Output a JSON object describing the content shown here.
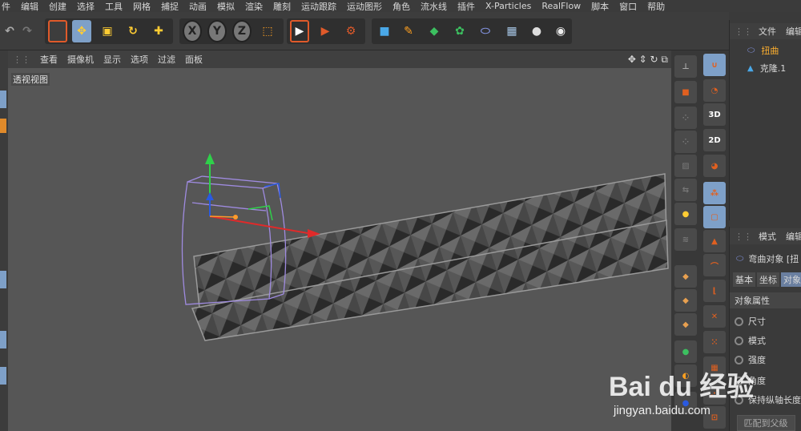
{
  "menu": [
    "件",
    "编辑",
    "创建",
    "选择",
    "工具",
    "网格",
    "捕捉",
    "动画",
    "模拟",
    "渲染",
    "雕刻",
    "运动跟踪",
    "运动图形",
    "角色",
    "流水线",
    "插件",
    "X-Particles",
    "RealFlow",
    "脚本",
    "窗口",
    "帮助"
  ],
  "toolbar": {
    "axis_x": "X",
    "axis_y": "Y",
    "axis_z": "Z"
  },
  "viewport": {
    "menu": [
      "查看",
      "摄像机",
      "显示",
      "选项",
      "过滤",
      "面板"
    ],
    "label": "透视视图"
  },
  "right_tools": {
    "btn_3d": "3D",
    "btn_2d": "2D"
  },
  "object_manager": {
    "tabs": [
      "文件",
      "编辑"
    ],
    "items": [
      {
        "name": "扭曲",
        "color": "#ffb02e"
      },
      {
        "name": "克隆.1",
        "color": "#d8d8d8"
      }
    ]
  },
  "attributes": {
    "tabs": [
      "模式",
      "编辑"
    ],
    "object_title": "弯曲对象 [扭",
    "subtabs": [
      "基本",
      "坐标",
      "对象"
    ],
    "section": "对象属性",
    "props": [
      "尺寸",
      "模式",
      "强度",
      "角度",
      "保持纵轴长度"
    ],
    "bottom_button": "匹配到父级"
  },
  "watermark": {
    "logo": "Bai du 经验",
    "url": "jingyan.baidu.com"
  }
}
